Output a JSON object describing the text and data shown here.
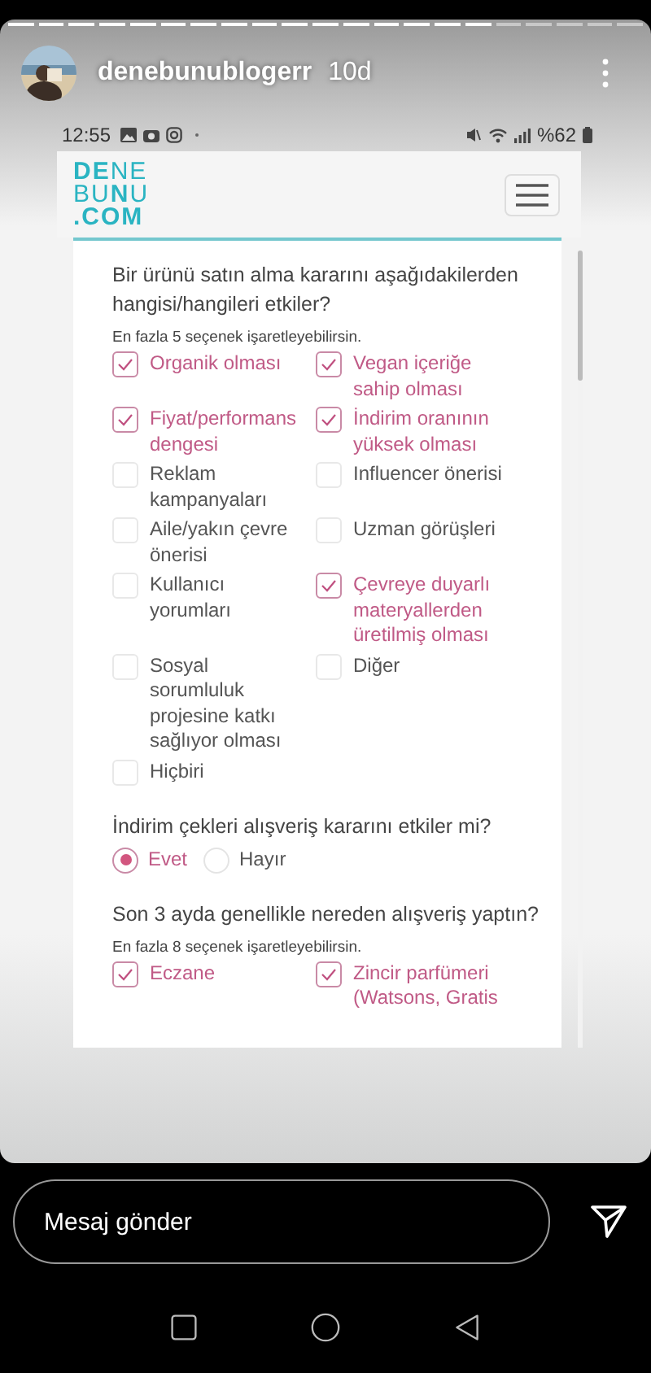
{
  "story": {
    "segments": [
      {
        "viewed": true
      },
      {
        "viewed": true
      },
      {
        "viewed": true
      },
      {
        "viewed": true
      },
      {
        "viewed": true
      },
      {
        "viewed": true
      },
      {
        "viewed": true
      },
      {
        "viewed": true
      },
      {
        "viewed": true
      },
      {
        "viewed": true
      },
      {
        "viewed": true
      },
      {
        "viewed": true
      },
      {
        "viewed": true
      },
      {
        "viewed": true
      },
      {
        "viewed": true
      },
      {
        "viewed": true
      },
      {
        "viewed": false
      },
      {
        "viewed": false
      },
      {
        "viewed": false
      },
      {
        "viewed": false
      },
      {
        "viewed": false
      }
    ],
    "username": "denebunublogerr",
    "time": "10d"
  },
  "status_bar": {
    "time": "12:55",
    "battery": "%62"
  },
  "site": {
    "logo": [
      "**DE**NE",
      "BU**N**U",
      "**.COM**"
    ]
  },
  "questions": [
    {
      "kind": "checkboxes",
      "text": "Bir ürünü satın alma kararını aşağıdakilerden hangisi/hangileri etkiler?",
      "hint": "En fazla 5 seçenek işaretleyebilirsin.",
      "options": [
        {
          "label": "Organik olması",
          "checked": true
        },
        {
          "label": "Vegan içeriğe sahip olması",
          "checked": true
        },
        {
          "label": "Fiyat/performans dengesi",
          "checked": true
        },
        {
          "label": "İndirim oranının yüksek olması",
          "checked": true
        },
        {
          "label": "Reklam kampanyaları",
          "checked": false
        },
        {
          "label": "Influencer önerisi",
          "checked": false
        },
        {
          "label": "Aile/yakın çevre önerisi",
          "checked": false
        },
        {
          "label": "Uzman görüşleri",
          "checked": false
        },
        {
          "label": "Kullanıcı yorumları",
          "checked": false
        },
        {
          "label": "Çevreye duyarlı materyallerden üretilmiş olması",
          "checked": true
        },
        {
          "label": "Sosyal sorumluluk projesine katkı sağlıyor olması",
          "checked": false
        },
        {
          "label": "Diğer",
          "checked": false
        },
        {
          "label": "Hiçbiri",
          "checked": false
        }
      ]
    },
    {
      "kind": "radio",
      "text": "İndirim çekleri alışveriş kararını etkiler mi?",
      "options": [
        {
          "label": "Evet",
          "selected": true
        },
        {
          "label": "Hayır",
          "selected": false
        }
      ]
    },
    {
      "kind": "checkboxes",
      "text": "Son 3 ayda genellikle nereden alışveriş yaptın?",
      "hint": "En fazla 8 seçenek işaretleyebilirsin.",
      "options": [
        {
          "label": "Eczane",
          "checked": true
        },
        {
          "label": "Zincir parfümeri (Watsons, Gratis",
          "checked": true
        }
      ]
    }
  ],
  "composer": {
    "placeholder": "Mesaj gönder"
  }
}
